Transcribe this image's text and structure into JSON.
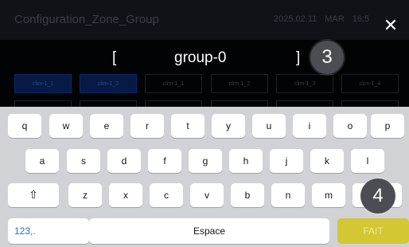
{
  "header": {
    "title": "Configuration_Zone_Group",
    "date": "2025.02.11",
    "day": "MAR",
    "time": "16:5"
  },
  "close_icon": "close-icon",
  "background_grid": {
    "row1": [
      "clim-1_1",
      "clim-1_2",
      "clim-1_1",
      "clim-1_2",
      "clim-1_3",
      "clim-1_4"
    ]
  },
  "name_input": {
    "bracket_left": "[",
    "value": "group-0",
    "bracket_right": "]"
  },
  "markers": {
    "step3": "3",
    "step4": "4"
  },
  "keyboard": {
    "row1": [
      "q",
      "w",
      "e",
      "r",
      "t",
      "y",
      "u",
      "i",
      "o",
      "p"
    ],
    "row2": [
      "a",
      "s",
      "d",
      "f",
      "g",
      "h",
      "j",
      "k",
      "l"
    ],
    "row3": [
      "z",
      "x",
      "c",
      "v",
      "b",
      "n",
      "m"
    ],
    "shift_icon": "shift-icon",
    "numbers_label": "123,.",
    "space_label": "Espace",
    "done_label": "FAIT"
  }
}
